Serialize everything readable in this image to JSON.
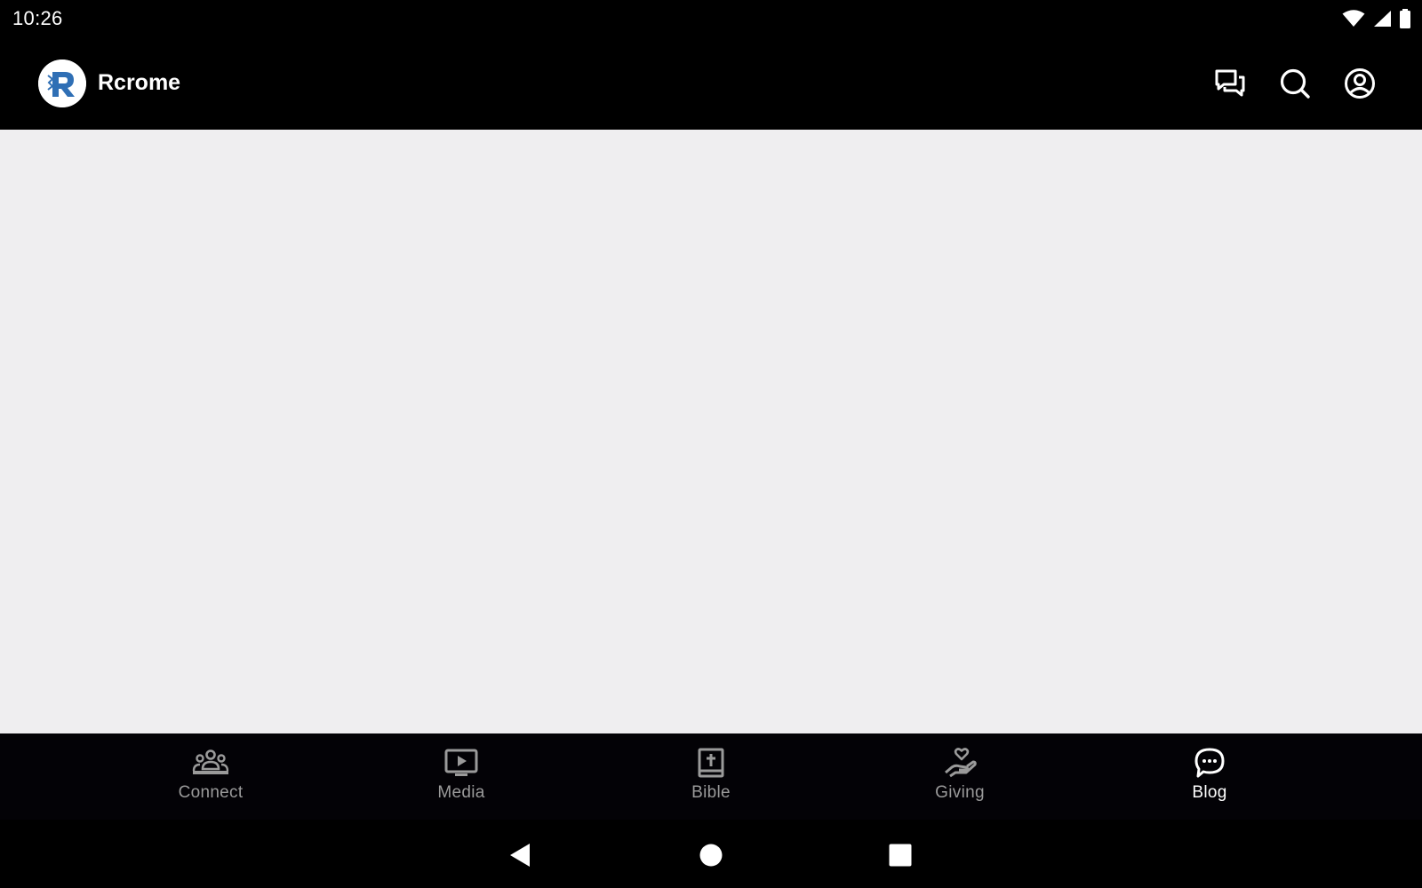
{
  "status_bar": {
    "time": "10:26",
    "icons": [
      "wifi-icon",
      "cell-signal-icon",
      "battery-icon"
    ]
  },
  "app_bar": {
    "title": "Rcrome",
    "logo_letter": "R",
    "actions": [
      "chat-icon",
      "search-icon",
      "account-circle-icon"
    ]
  },
  "bottom_nav": {
    "items": [
      {
        "label": "Connect",
        "icon": "people-group-icon",
        "active": false
      },
      {
        "label": "Media",
        "icon": "tv-play-icon",
        "active": false
      },
      {
        "label": "Bible",
        "icon": "bible-icon",
        "active": false
      },
      {
        "label": "Giving",
        "icon": "giving-hand-icon",
        "active": false
      },
      {
        "label": "Blog",
        "icon": "chat-bubble-dots-icon",
        "active": true
      }
    ]
  },
  "system_nav": {
    "buttons": [
      "back-icon",
      "home-icon",
      "recents-icon"
    ]
  },
  "colors": {
    "bar_background": "#000000",
    "content_background": "#efeef0",
    "inactive_label": "#9a9a9a",
    "active_label": "#ffffff",
    "logo_blue": "#2f6fb5"
  }
}
